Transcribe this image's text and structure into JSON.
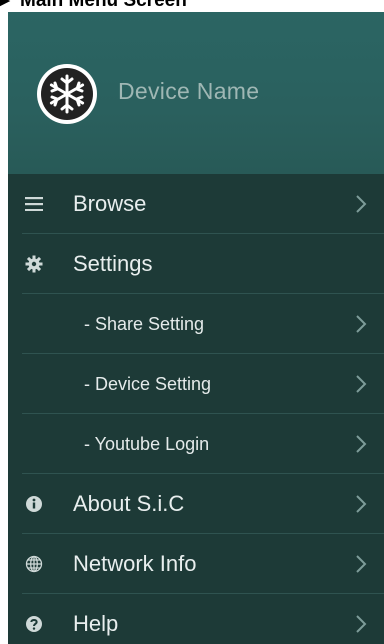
{
  "caption": {
    "text": "Main Menu Screen"
  },
  "header": {
    "device_name": "Device Name",
    "avatar_icon": "snowflake-icon"
  },
  "menu": {
    "items": [
      {
        "label": "Browse",
        "icon": "hamburger-icon",
        "has_chevron": true
      },
      {
        "label": "Settings",
        "icon": "gear-icon",
        "has_chevron": false
      },
      {
        "label": "- Share Setting",
        "icon": null,
        "has_chevron": true
      },
      {
        "label": "- Device Setting",
        "icon": null,
        "has_chevron": true
      },
      {
        "label": "- Youtube Login",
        "icon": null,
        "has_chevron": true
      },
      {
        "label": "About S.i.C",
        "icon": "info-icon",
        "has_chevron": true
      },
      {
        "label": "Network Info",
        "icon": "globe-icon",
        "has_chevron": true
      },
      {
        "label": "Help",
        "icon": "help-icon",
        "has_chevron": true
      }
    ]
  },
  "colors": {
    "header_bg": "#2b6563",
    "menu_bg": "#1d3a37",
    "divider": "#2f5350",
    "text": "#e8eeee",
    "device_name_text": "#9fb7b4"
  }
}
